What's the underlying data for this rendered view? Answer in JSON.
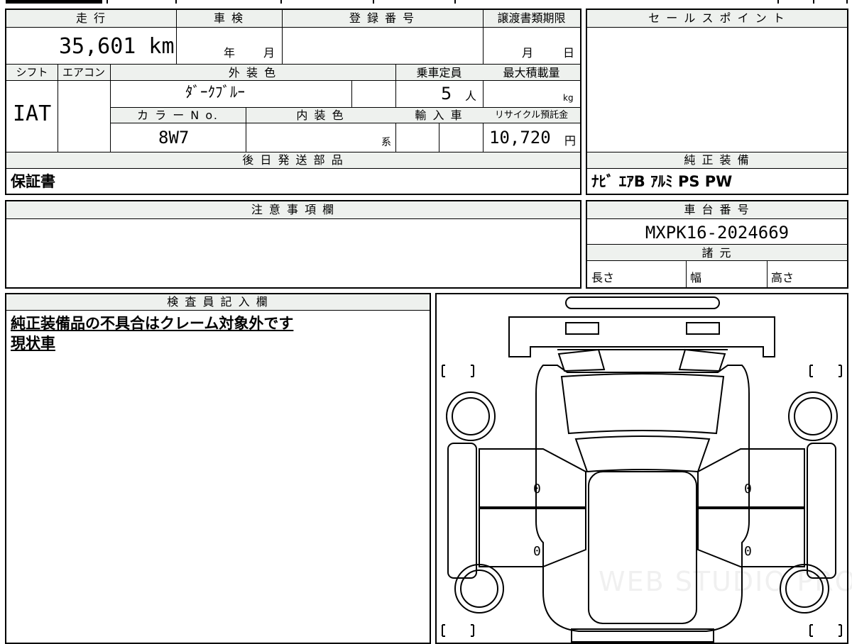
{
  "top": {
    "mileage_label": "走 行",
    "mileage_value": "35,601 km",
    "inspection_label": "車 検",
    "inspection_year": "年",
    "inspection_month": "月",
    "registration_label": "登 録 番 号",
    "transfer_label": "譲渡書類期限",
    "transfer_month": "月",
    "transfer_day": "日",
    "shift_label": "シフト",
    "aircon_label": "エアコン",
    "exterior_label": "外 装 色",
    "exterior_value": "ﾀﾞｰｸﾌﾞﾙｰ",
    "capacity_label": "乗車定員",
    "capacity_value": "5",
    "capacity_unit": "人",
    "maxload_label": "最大積載量",
    "maxload_unit": "kg",
    "shift_value": "IAT",
    "color_no_label": "カ ラ ー N o.",
    "color_no_value": "8W7",
    "interior_label": "内 装 色",
    "interior_suffix": "系",
    "import_label": "輸 入 車",
    "recycle_label": "リサイクル預託金",
    "recycle_value": "10,720",
    "recycle_unit": "円",
    "parts_label": "後 日 発 送 部 品",
    "parts_value": "保証書"
  },
  "sales": {
    "label": "セ ー ル ス ポ イ ン ト",
    "equipment_label": "純 正 装 備",
    "equipment_value": "ﾅﾋﾞ ｴｱB ｱﾙﾐ PS PW"
  },
  "notes": {
    "label": "注 意 事 項 欄"
  },
  "chassis": {
    "label": "車 台 番 号",
    "value": "MXPK16-2024669",
    "specs_label": "諸 元",
    "length_label": "長さ",
    "width_label": "幅",
    "height_label": "高さ"
  },
  "inspector": {
    "label": "検 査 員 記 入 欄",
    "line1": "純正装備品の不具合はクレーム対象外です",
    "line2": "現状車"
  },
  "diagram": {
    "marks": [
      "0",
      "0",
      "0",
      "0"
    ],
    "watermark": "WEB STUDIO PRO"
  }
}
